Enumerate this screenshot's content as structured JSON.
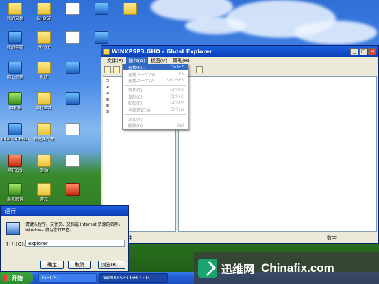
{
  "window": {
    "title": "WINXPSP3.GHO - Ghost Explorer",
    "menu": [
      "文件(F)",
      "视图(V)",
      "帮助(H)"
    ],
    "active_menu": "操作(A)",
    "status_left": "显示指定文件",
    "status_right": "数字"
  },
  "dropdown": {
    "items": [
      {
        "label": "查找(F)...",
        "key": "Ctrl+F"
      },
      {
        "label": "查找下一个(N)",
        "key": "F3"
      },
      {
        "label": "查找上一个(V)",
        "key": "Shift+F3"
      },
      {
        "label": "剪切(T)",
        "key": "Ctrl+X"
      },
      {
        "label": "复制(C)",
        "key": "Ctrl+C"
      },
      {
        "label": "粘贴(P)",
        "key": "Ctrl+V"
      },
      {
        "label": "全部选定(A)",
        "key": "Ctrl+A"
      },
      {
        "label": "添加(A)",
        "key": ""
      },
      {
        "label": "删除(D)",
        "key": "Del"
      }
    ]
  },
  "desktop_icons": [
    {
      "label": "我的文档"
    },
    {
      "label": "我的电脑"
    },
    {
      "label": "网上邻居"
    },
    {
      "label": "回收站"
    },
    {
      "label": "Internet Explorer"
    },
    {
      "label": "腾讯QQ"
    },
    {
      "label": "暴风影音"
    },
    {
      "label": "GHOST"
    },
    {
      "label": "WinXP"
    },
    {
      "label": "系统"
    },
    {
      "label": "装机工具"
    },
    {
      "label": "新建文件夹"
    },
    {
      "label": "驱动"
    },
    {
      "label": "游戏"
    }
  ],
  "run_dialog": {
    "title": "运行",
    "desc": "请键入程序、文件夹、文档或 Internet 资源的名称，Windows 将为您打开它。",
    "open_label": "打开(O):",
    "value": "explorer",
    "ok": "确定",
    "cancel": "取消",
    "browse": "浏览(B)..."
  },
  "taskbar": {
    "start": "开始",
    "tasks": [
      "GHOST",
      "WINXPSP3.GHO - G..."
    ]
  },
  "watermark": {
    "cn": "迅维网",
    "en": "Chinafix.com"
  }
}
